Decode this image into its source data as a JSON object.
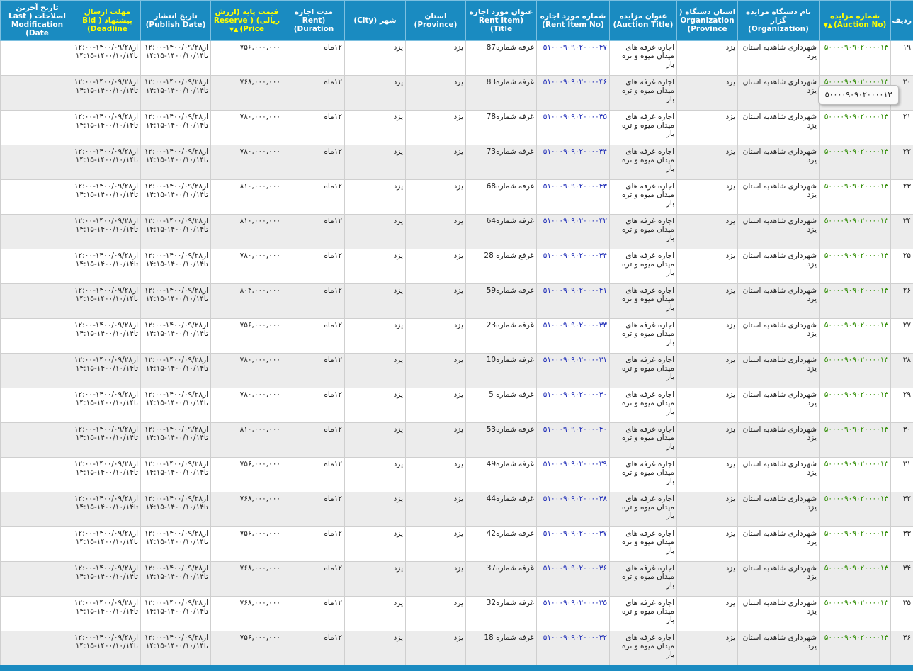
{
  "columns": [
    {
      "key": "row",
      "label": "ردیف",
      "highlight": false,
      "sort": false
    },
    {
      "key": "auction_no",
      "label": "شماره مزایده (Auction No)",
      "highlight": true,
      "sort": true
    },
    {
      "key": "organization",
      "label": "نام دستگاه مزایده گزار (Organization)",
      "highlight": false,
      "sort": false
    },
    {
      "key": "org_province",
      "label": "استان دستگاه ( Organization Province)",
      "highlight": false,
      "sort": false
    },
    {
      "key": "auction_title",
      "label": "عنوان مزایده (Auction Title)",
      "highlight": false,
      "sort": false
    },
    {
      "key": "rent_item_no",
      "label": "شماره مورد اجاره (Rent Item No)",
      "highlight": false,
      "sort": false
    },
    {
      "key": "rent_item_title",
      "label": "عنوان مورد اجاره (Rent Item Title)",
      "highlight": false,
      "sort": false
    },
    {
      "key": "province",
      "label": "استان (Province)",
      "highlight": false,
      "sort": false
    },
    {
      "key": "city",
      "label": "شهر (City)",
      "highlight": false,
      "sort": false
    },
    {
      "key": "duration",
      "label": "مدت اجاره (Rent Duration)",
      "highlight": false,
      "sort": false
    },
    {
      "key": "price",
      "label": "قیمت پایه (ارزش ریالی) ( Reserve Price)",
      "highlight": true,
      "sort": true
    },
    {
      "key": "publish",
      "label": "تاریخ انتشار (Publish Date)",
      "highlight": false,
      "sort": false
    },
    {
      "key": "deadline",
      "label": "مهلت ارسال پیشنهاد ( Bid Deadline)",
      "highlight": true,
      "sort": false
    },
    {
      "key": "modified",
      "label": "تاریخ آخرین اصلاحات ( Last Modification Date)",
      "highlight": false,
      "sort": false
    }
  ],
  "shared": {
    "auction_no": "۵۰۰۰۰۹۰۹۰۲۰۰۰۰۱۳",
    "organization": "شهرداری شاهدیه استان یزد",
    "org_province": "یزد",
    "auction_title": "اجاره غرفه های میدان میوه و تره بار",
    "province": "یزد",
    "city": "یزد",
    "duration": "۱۲ماه",
    "publish": "از۱۴۰۰/۰۹/۲۸-۱۲:۰۰ تا۱۴۰۰/۱۰/۱۴-۱۴:۱۵",
    "deadline": "از۱۴۰۰/۰۹/۲۸-۱۲:۰۰ تا۱۴۰۰/۱۰/۱۴-۱۴:۱۵",
    "modified": ""
  },
  "rows": [
    {
      "row": "۱۹",
      "rent_item_no": "۵۱۰۰۰۹۰۹۰۲۰۰۰۰۴۷",
      "rent_item_title": "غرفه شماره87",
      "price": "۷۵۶,۰۰۰,۰۰۰"
    },
    {
      "row": "۲۰",
      "rent_item_no": "۵۱۰۰۰۹۰۹۰۲۰۰۰۰۴۶",
      "rent_item_title": "غرفه شماره83",
      "price": "۷۶۸,۰۰۰,۰۰۰"
    },
    {
      "row": "۲۱",
      "rent_item_no": "۵۱۰۰۰۹۰۹۰۲۰۰۰۰۴۵",
      "rent_item_title": "غرفه شماره78",
      "price": "۷۸۰,۰۰۰,۰۰۰"
    },
    {
      "row": "۲۲",
      "rent_item_no": "۵۱۰۰۰۹۰۹۰۲۰۰۰۰۴۴",
      "rent_item_title": "غرفه شماره73",
      "price": "۷۸۰,۰۰۰,۰۰۰"
    },
    {
      "row": "۲۳",
      "rent_item_no": "۵۱۰۰۰۹۰۹۰۲۰۰۰۰۴۳",
      "rent_item_title": "غرفه شماره68",
      "price": "۸۱۰,۰۰۰,۰۰۰"
    },
    {
      "row": "۲۴",
      "rent_item_no": "۵۱۰۰۰۹۰۹۰۲۰۰۰۰۴۲",
      "rent_item_title": "غرفه شماره64",
      "price": "۸۱۰,۰۰۰,۰۰۰"
    },
    {
      "row": "۲۵",
      "rent_item_no": "۵۱۰۰۰۹۰۹۰۲۰۰۰۰۳۴",
      "rent_item_title": "غرفع شماره 28",
      "price": "۷۸۰,۰۰۰,۰۰۰"
    },
    {
      "row": "۲۶",
      "rent_item_no": "۵۱۰۰۰۹۰۹۰۲۰۰۰۰۴۱",
      "rent_item_title": "غرفه شماره59",
      "price": "۸۰۴,۰۰۰,۰۰۰"
    },
    {
      "row": "۲۷",
      "rent_item_no": "۵۱۰۰۰۹۰۹۰۲۰۰۰۰۳۳",
      "rent_item_title": "غرفه شماره23",
      "price": "۷۵۶,۰۰۰,۰۰۰"
    },
    {
      "row": "۲۸",
      "rent_item_no": "۵۱۰۰۰۹۰۹۰۲۰۰۰۰۳۱",
      "rent_item_title": "غرفه شماره10",
      "price": "۷۸۰,۰۰۰,۰۰۰"
    },
    {
      "row": "۲۹",
      "rent_item_no": "۵۱۰۰۰۹۰۹۰۲۰۰۰۰۳۰",
      "rent_item_title": "غرفه شماره 5",
      "price": "۷۸۰,۰۰۰,۰۰۰"
    },
    {
      "row": "۳۰",
      "rent_item_no": "۵۱۰۰۰۹۰۹۰۲۰۰۰۰۴۰",
      "rent_item_title": "غرفه شماره53",
      "price": "۸۱۰,۰۰۰,۰۰۰"
    },
    {
      "row": "۳۱",
      "rent_item_no": "۵۱۰۰۰۹۰۹۰۲۰۰۰۰۳۹",
      "rent_item_title": "غرفه شماره49",
      "price": "۷۵۶,۰۰۰,۰۰۰"
    },
    {
      "row": "۳۲",
      "rent_item_no": "۵۱۰۰۰۹۰۹۰۲۰۰۰۰۳۸",
      "rent_item_title": "غرفه شماره44",
      "price": "۷۶۸,۰۰۰,۰۰۰"
    },
    {
      "row": "۳۳",
      "rent_item_no": "۵۱۰۰۰۹۰۹۰۲۰۰۰۰۳۷",
      "rent_item_title": "غرفه شماره42",
      "price": "۷۵۶,۰۰۰,۰۰۰"
    },
    {
      "row": "۳۴",
      "rent_item_no": "۵۱۰۰۰۹۰۹۰۲۰۰۰۰۳۶",
      "rent_item_title": "غرفه شماره37",
      "price": "۷۶۸,۰۰۰,۰۰۰"
    },
    {
      "row": "۳۵",
      "rent_item_no": "۵۱۰۰۰۹۰۹۰۲۰۰۰۰۳۵",
      "rent_item_title": "غرفه شماره32",
      "price": "۷۶۸,۰۰۰,۰۰۰"
    },
    {
      "row": "۳۶",
      "rent_item_no": "۵۱۰۰۰۹۰۹۰۲۰۰۰۰۳۲",
      "rent_item_title": "غرفه شماره 18",
      "price": "۷۵۶,۰۰۰,۰۰۰"
    }
  ],
  "tooltip": {
    "text": "۵۰۰۰۰۹۰۹۰۲۰۰۰۰۱۳"
  },
  "colors": {
    "header_bg": "#1a8bc1",
    "highlight_header": "#ffff00",
    "auction_link": "#2e8b00",
    "item_link": "#1d2bb6"
  }
}
